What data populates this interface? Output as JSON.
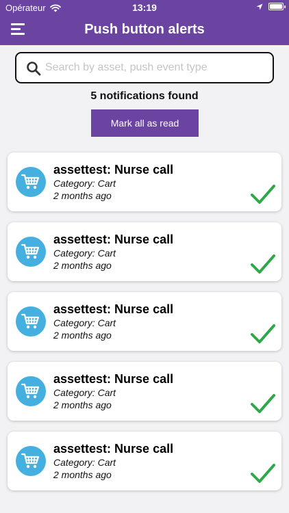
{
  "status_bar": {
    "carrier": "Opérateur",
    "time": "13:19"
  },
  "header": {
    "title": "Push button alerts"
  },
  "search": {
    "placeholder": "Search by asset, push event type",
    "value": ""
  },
  "summary": {
    "count_text": "5 notifications found"
  },
  "actions": {
    "mark_all_label": "Mark all as read"
  },
  "colors": {
    "primary": "#6a44a0",
    "icon_bg": "#45b0e0",
    "check": "#2fa84a"
  },
  "notifications": [
    {
      "title": "assettest: Nurse call",
      "category": "Category: Cart",
      "time": "2 months ago",
      "icon": "cart-icon",
      "read": true
    },
    {
      "title": "assettest: Nurse call",
      "category": "Category: Cart",
      "time": "2 months ago",
      "icon": "cart-icon",
      "read": true
    },
    {
      "title": "assettest: Nurse call",
      "category": "Category: Cart",
      "time": "2 months ago",
      "icon": "cart-icon",
      "read": true
    },
    {
      "title": "assettest: Nurse call",
      "category": "Category: Cart",
      "time": "2 months ago",
      "icon": "cart-icon",
      "read": true
    },
    {
      "title": "assettest: Nurse call",
      "category": "Category: Cart",
      "time": "2 months ago",
      "icon": "cart-icon",
      "read": true
    }
  ]
}
